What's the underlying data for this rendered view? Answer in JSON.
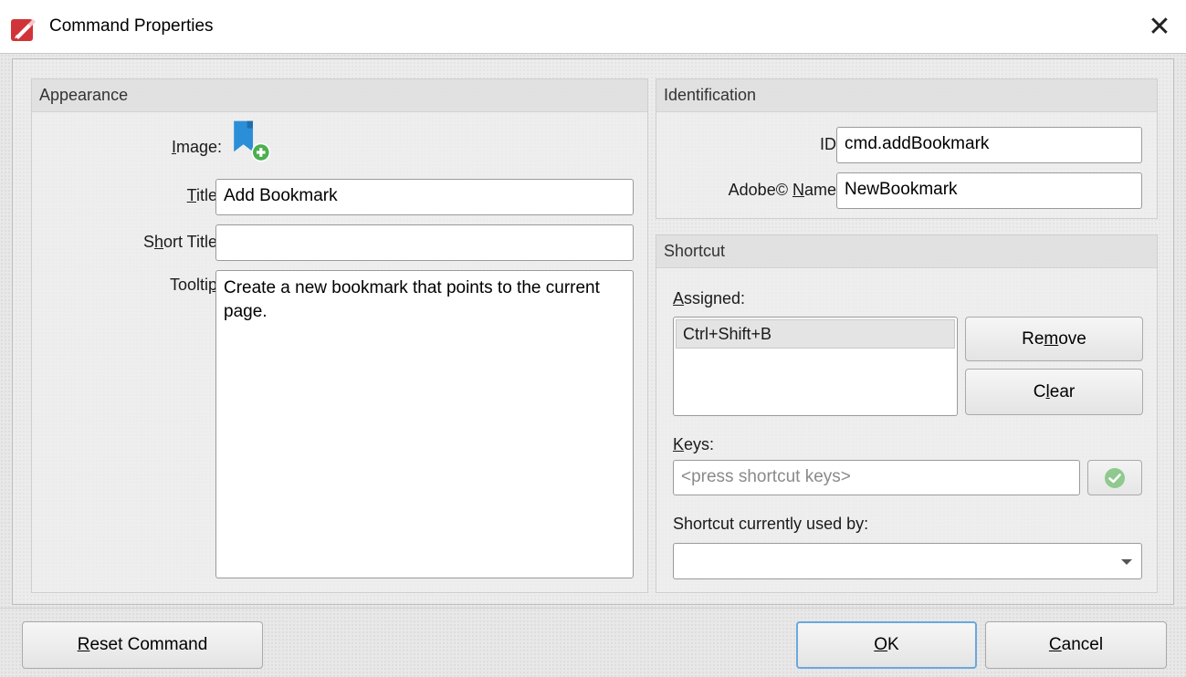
{
  "window": {
    "title": "Command Properties",
    "close_glyph": "✕",
    "icon": "pdf-app-icon"
  },
  "appearance": {
    "group_title": "Appearance",
    "image_label_pre": "",
    "image_label_ul": "I",
    "image_label_post": "mage:",
    "image_icon": "add-bookmark-icon",
    "title_label_ul": "T",
    "title_label_post": "itle:",
    "title_value": "Add Bookmark",
    "short_title_label_pre": "S",
    "short_title_label_ul": "h",
    "short_title_label_post": "ort Title:",
    "short_title_value": "",
    "tooltip_label_pre": "Toolti",
    "tooltip_label_ul": "p",
    "tooltip_label_post": ":",
    "tooltip_value": "Create a new bookmark that points to the current page."
  },
  "identification": {
    "group_title": "Identification",
    "id_label": "ID:",
    "id_value": "cmd.addBookmark",
    "adobe_label_pre": "Adobe© ",
    "adobe_label_ul": "N",
    "adobe_label_post": "ame:",
    "adobe_value": "NewBookmark"
  },
  "shortcut": {
    "group_title": "Shortcut",
    "assigned_label_ul": "A",
    "assigned_label_post": "ssigned:",
    "assigned_items": [
      "Ctrl+Shift+B"
    ],
    "remove_pre": "Re",
    "remove_ul": "m",
    "remove_post": "ove",
    "clear_pre": "C",
    "clear_ul": "l",
    "clear_post": "ear",
    "keys_label_ul": "K",
    "keys_label_post": "eys:",
    "keys_placeholder": "<press shortcut keys>",
    "apply_icon": "check-circle-icon",
    "used_by_label": "Shortcut currently used by:",
    "used_by_value": ""
  },
  "footer": {
    "reset_ul": "R",
    "reset_post": "eset Command",
    "ok_ul": "O",
    "ok_post": "K",
    "cancel_ul": "C",
    "cancel_post": "ancel"
  },
  "colors": {
    "accent_focus": "#6aa8dd",
    "app_icon_red": "#d13438",
    "bookmark_blue": "#2b8fd8",
    "add_green": "#4caf50"
  }
}
